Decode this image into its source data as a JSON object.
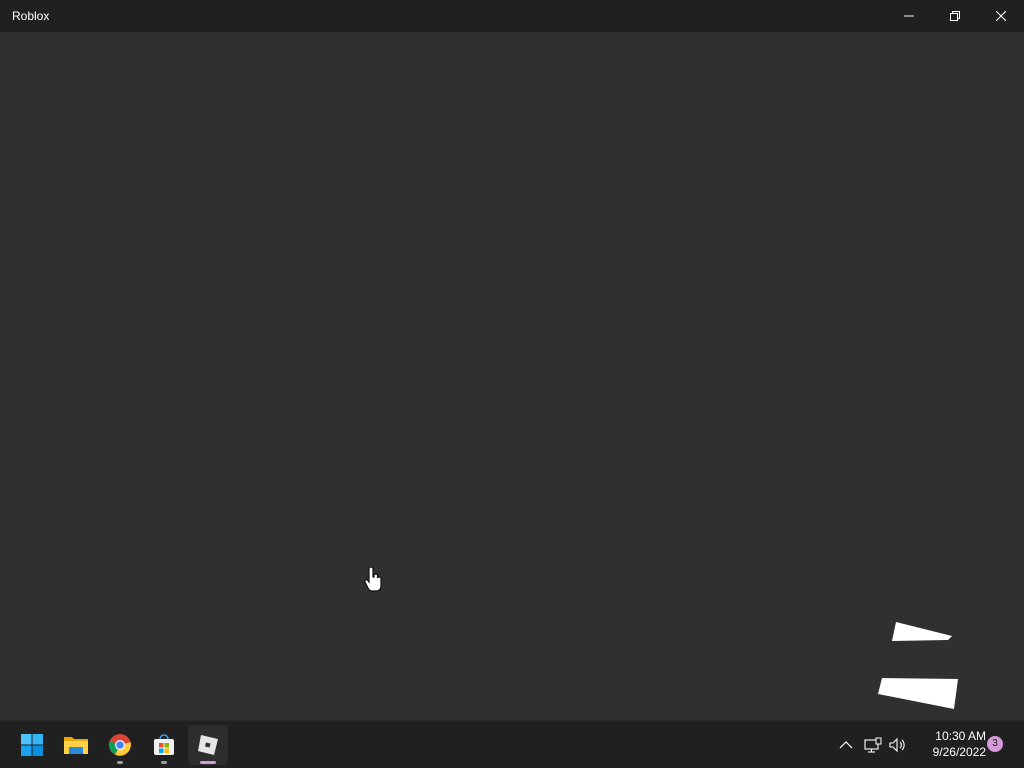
{
  "window": {
    "title": "Roblox"
  },
  "taskbar": {
    "apps": [
      {
        "name": "Start",
        "icon": "windows-start-icon"
      },
      {
        "name": "File Explorer",
        "icon": "folder-icon"
      },
      {
        "name": "Google Chrome",
        "icon": "chrome-icon"
      },
      {
        "name": "Microsoft Store",
        "icon": "store-icon"
      },
      {
        "name": "Roblox",
        "icon": "roblox-icon",
        "active": true
      }
    ],
    "tray": {
      "time": "10:30 AM",
      "date": "9/26/2022",
      "notification_count": "3"
    }
  },
  "colors": {
    "background": "#303030",
    "titlebar": "#202020",
    "taskbar": "#202020",
    "accent": "#d49bd8"
  }
}
